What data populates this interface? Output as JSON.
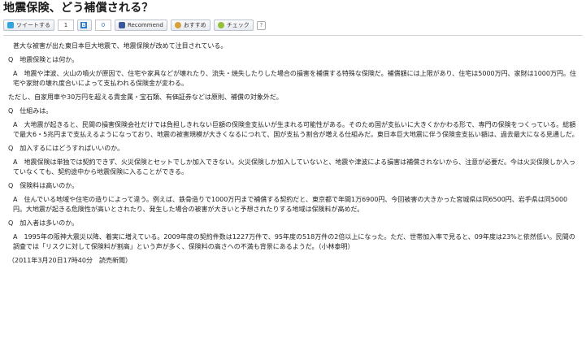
{
  "article": {
    "title": "地震保険、どう補償される？"
  },
  "share": {
    "tweet_label": "ツイートする",
    "tweet_count": "1",
    "hatena_icon": "B",
    "hatena_count": "0",
    "facebook_label": "Recommend",
    "mixi_label": "おすすめ",
    "check_label": "チェック",
    "help_label": "?"
  },
  "content": {
    "intro": "甚大な被害が出た東日本巨大地震で、地震保険が改めて注目されている。",
    "q1": "Q　地震保険とは何か。",
    "a1": "A　地震や津波、火山の噴火が原因で、住宅や家具などが壊れたり、流失・焼失したりした場合の損害を補償する特殊な保険だ。補償額には上限があり、住宅は5000万円、家財は1000万円。住宅や家財の壊れ度合いによって支払われる保険金が変わる。",
    "a1b": "ただし、自家用車や30万円を超える貴金属・宝石類、有価証券などは原則、補償の対象外だ。",
    "q2": "Q　仕組みは。",
    "a2": "A　大地震が起きると、民間の損害保険会社だけでは負担しきれない巨額の保険金支払いが生まれる可能性がある。そのため国が支払いに大きくかかわる形で、専門の保険をつくっている。総額で最大6・5兆円まで支払えるようになっており、地震の被害規模が大きくなるにつれて、国が支払う割合が増える仕組みだ。東日本巨大地震に伴う保険金支払い額は、過去最大になる見通しだ。",
    "q3": "Q　加入するにはどうすればいいのか。",
    "a3": "A　地震保険は単独では契約できず、火災保険とセットでしか加入できない。火災保険しか加入していないと、地震や津波による損害は補償されないから、注意が必要だ。今は火災保険しか入っていなくても、契約途中から地震保険に入ることができる。",
    "q4": "Q　保険料は高いのか。",
    "a4": "A　住んでいる地域や住宅の造りによって違う。例えば、鉄骨造りで1000万円まで補償する契約だと、東京都で年間1万6900円、今回被害の大きかった宮城県は同6500円、岩手県は同5000円。大地震が起きる危険性が高いとされたり、発生した場合の被害が大きいと予想されたりする地域は保険料が高めだ。",
    "q5": "Q　加入者は多いのか。",
    "a5": "A　1995年の阪神大震災以降、着実に増えている。2009年度の契約件数は1227万件で、95年度の518万件の2倍以上になった。ただ、世帯加入率で見ると、09年度は23%と依然低い。民間の調査では「リスクに対して保険料が割高」という声が多く、保険料の高さへの不満も背景にあるようだ。（小林泰明）",
    "credit": "（2011年3月20日17時40分　読売新聞）"
  }
}
